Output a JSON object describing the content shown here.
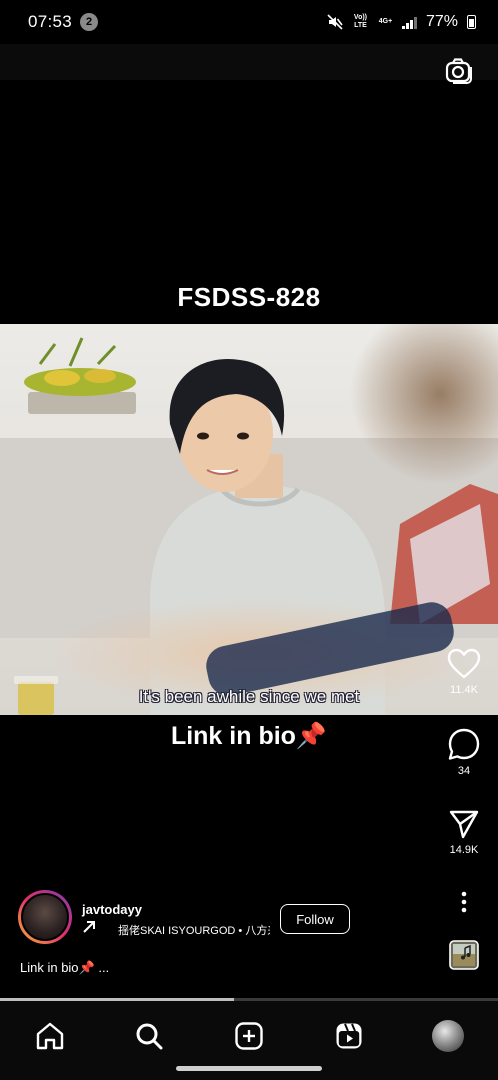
{
  "status_bar": {
    "time": "07:53",
    "notification_count": "2",
    "volte_label": "Vo)) LTE",
    "network_label": "4G+",
    "battery": "77%"
  },
  "post": {
    "overlay_title": "FSDSS-828",
    "subtitle": "It's been awhile since we met",
    "overlay_caption": "Link in bio📌"
  },
  "actions": {
    "likes": "11.4K",
    "comments": "34",
    "shares": "14.9K"
  },
  "author": {
    "username": "javtodayy",
    "music": "揺佬SKAI ISYOURGOD • 八方来",
    "follow_label": "Follow"
  },
  "caption": "Link in bio📌 ...",
  "playback": {
    "progress": 0.47
  },
  "colors": {
    "background": "#000000",
    "story_ring_start": "#f9b233",
    "story_ring_mid": "#e1306c",
    "story_ring_end": "#833ab4"
  },
  "icons": {
    "camera": "camera-icon",
    "like": "heart-icon",
    "comment": "comment-icon",
    "share": "send-icon",
    "more": "more-vertical-icon",
    "audio": "audio-thumbnail-icon",
    "nav": [
      "home-icon",
      "search-icon",
      "create-icon",
      "reels-icon",
      "profile-avatar"
    ]
  }
}
